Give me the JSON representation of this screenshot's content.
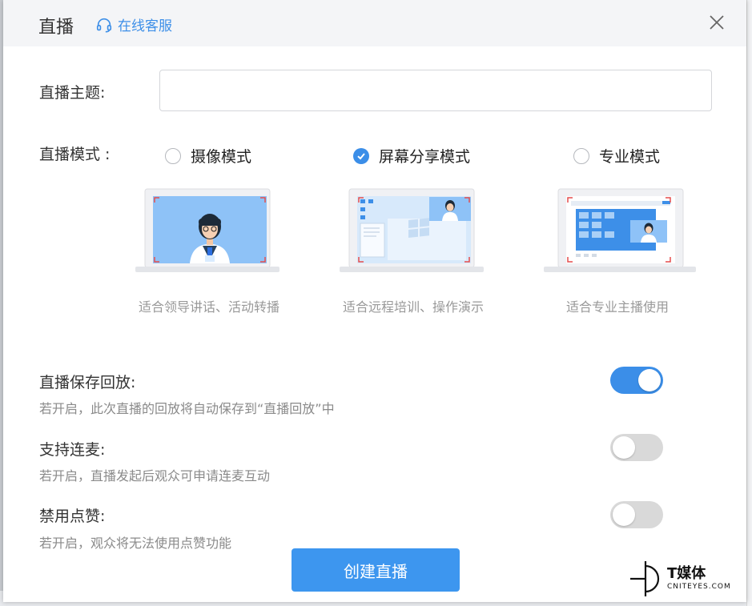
{
  "dialog": {
    "title": "直播",
    "service_link": "在线客服",
    "close_icon": "close-icon"
  },
  "topic": {
    "label": "直播主题:",
    "value": "",
    "placeholder": ""
  },
  "mode": {
    "label": "直播模式 :",
    "options": [
      {
        "label": "摄像模式",
        "checked": false,
        "desc": "适合领导讲话、活动转播"
      },
      {
        "label": "屏幕分享模式",
        "checked": true,
        "desc": "适合远程培训、操作演示"
      },
      {
        "label": "专业模式",
        "checked": false,
        "desc": "适合专业主播使用"
      }
    ]
  },
  "settings": [
    {
      "title": "直播保存回放:",
      "desc": "若开启，此次直播的回放将自动保存到“直播回放”中",
      "enabled": true
    },
    {
      "title": "支持连麦:",
      "desc": "若开启，直播发起后观众可申请连麦互动",
      "enabled": false
    },
    {
      "title": "禁用点赞:",
      "desc": "若开启，观众将无法使用点赞功能",
      "enabled": false
    }
  ],
  "create_button": "创建直播",
  "watermark": {
    "main": "T媒体",
    "sub": "CNITEYES.COM"
  },
  "colors": {
    "accent": "#3b8ee8",
    "button": "#3d96ef",
    "toggle_off": "#d9d9d9"
  }
}
